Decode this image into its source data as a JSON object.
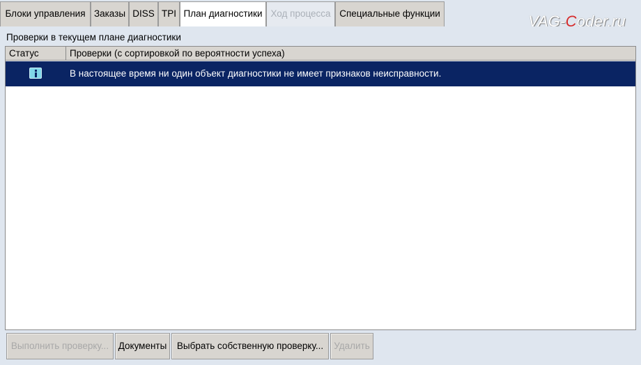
{
  "tabs": [
    {
      "label": "Блоки управления",
      "state": "normal"
    },
    {
      "label": "Заказы",
      "state": "normal"
    },
    {
      "label": "DISS",
      "state": "normal"
    },
    {
      "label": "TPI",
      "state": "normal"
    },
    {
      "label": "План диагностики",
      "state": "active"
    },
    {
      "label": "Ход процесса",
      "state": "disabled"
    },
    {
      "label": "Специальные функции",
      "state": "normal"
    }
  ],
  "watermark": {
    "prefix": "VAG-",
    "highlight": "C",
    "suffix": "oder.ru"
  },
  "panel": {
    "title": "Проверки в текущем плане диагностики"
  },
  "table": {
    "columns": [
      "Статус",
      "Проверки (с сортировкой по вероятности успеха)"
    ],
    "rows": [
      {
        "status_icon": "info-icon",
        "text": "В настоящее время ни один объект диагностики не имеет признаков неисправности."
      }
    ]
  },
  "buttons": [
    {
      "label": "Выполнить проверку...",
      "state": "disabled"
    },
    {
      "label": "Документы",
      "state": "enabled"
    },
    {
      "label": "Выбрать собственную проверку...",
      "state": "enabled"
    },
    {
      "label": "Удалить",
      "state": "disabled"
    }
  ],
  "colors": {
    "background": "#dfe6ef",
    "tab": "#d8d5d0",
    "selected_row": "#0a2463",
    "info_icon": "#7fd7e8",
    "watermark_accent": "#d62b2b"
  }
}
